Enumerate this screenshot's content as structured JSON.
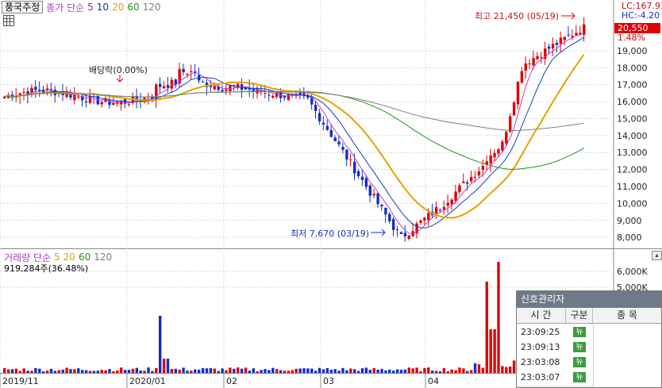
{
  "toolbar": {
    "stock_name": "풍국주정",
    "price_label": "종가 단순",
    "ma5": "5",
    "ma10": "10",
    "ma20": "20",
    "ma60": "60",
    "ma120": "120"
  },
  "volume_toolbar": {
    "label": "거래량 단순",
    "ma5": "5",
    "ma20": "20",
    "ma60": "60",
    "ma120": "120",
    "current": "919,284주(36.48%)"
  },
  "right_panel": {
    "lc": "LC:167.93",
    "hc": "HC:-4.20",
    "current_price": "20,550",
    "change_pct": "1.48%"
  },
  "annotations": {
    "high": "최고 21,450 (05/19)",
    "low": "최저 7,670 (03/19)",
    "dividend": "배당락(0.00%)"
  },
  "colors": {
    "up": "#e00000",
    "down": "#1030c8",
    "ma5": "#c040d0",
    "ma10": "#1040c0",
    "ma20": "#e8a000",
    "ma60": "#209020",
    "ma120": "#808080",
    "grid": "#d8d8d8",
    "news_badge": "#3c9c3c",
    "signal_title_bg": "#6f7a88"
  },
  "signal_panel": {
    "title": "신호관리자",
    "col_time": "시 간",
    "col_type": "구분",
    "col_item": "종 목",
    "rows": [
      {
        "time": "23:09:25",
        "type": "뉴"
      },
      {
        "time": "23:09:13",
        "type": "뉴"
      },
      {
        "time": "23:03:08",
        "type": "뉴"
      },
      {
        "time": "23:03:07",
        "type": "뉴"
      }
    ]
  },
  "chart_data": {
    "type": "candlestick",
    "price_axis": {
      "ticks": [
        19000,
        18000,
        17000,
        16000,
        15000,
        14000,
        13000,
        12000,
        11000,
        10000,
        9000,
        8000
      ],
      "tick_labels": [
        "19,000",
        "18,000",
        "17,000",
        "16,000",
        "15,000",
        "14,000",
        "13,000",
        "12,000",
        "11,000",
        "10,000",
        "9,000",
        "8,000"
      ],
      "range": [
        7400,
        21800
      ]
    },
    "volume_axis": {
      "ticks": [
        6000,
        5000
      ],
      "tick_labels": [
        "6,000K",
        "5,000K"
      ],
      "unit": "K"
    },
    "x_labels": [
      "2019/11",
      "2020/01",
      "02",
      "03",
      "04"
    ],
    "high": {
      "value": 21450,
      "date": "05/19"
    },
    "low": {
      "value": 7670,
      "date": "03/19"
    },
    "last_close": 20550,
    "volume_current": 919284,
    "series": [
      {
        "name": "5",
        "values": []
      },
      {
        "name": "10",
        "values": []
      },
      {
        "name": "20",
        "values": []
      },
      {
        "name": "60",
        "values": []
      },
      {
        "name": "120",
        "values": []
      }
    ]
  }
}
